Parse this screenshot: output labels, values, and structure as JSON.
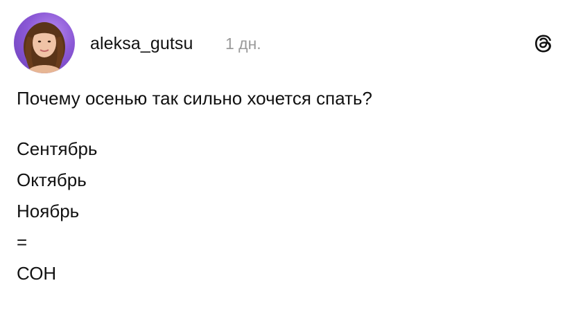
{
  "post": {
    "author": {
      "username": "aleksa_gutsu",
      "avatar_icon": "user-avatar-photo"
    },
    "timestamp": "1 дн.",
    "app_icon": "threads-logo-icon",
    "question": "Почему осенью так сильно хочется спать?",
    "lines": [
      {
        "text": "Сентябрь"
      },
      {
        "text": "Октябрь"
      },
      {
        "text": "Ноябрь"
      },
      {
        "text": "="
      },
      {
        "text": "СОН"
      }
    ]
  }
}
